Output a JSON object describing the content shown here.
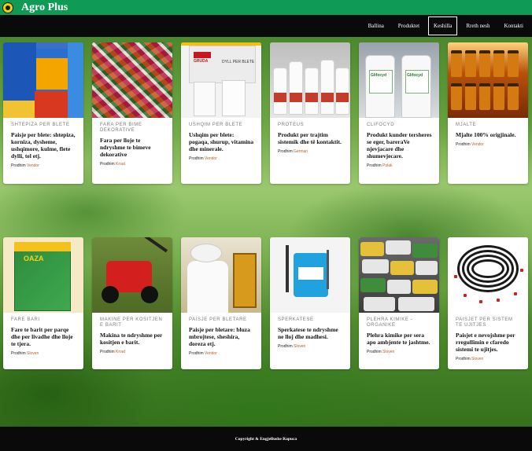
{
  "header": {
    "brand": "Agro Plus",
    "logo_icon": "sunflower-logo-icon"
  },
  "nav": {
    "items": [
      "Ballina",
      "Produktet",
      "Keshilla",
      "Rreth nesh",
      "Kontakti"
    ],
    "active": "Keshilla"
  },
  "origin_label": "Prodhim",
  "cards": [
    {
      "category": "Shtepiza per blete",
      "title": "Paisje per blete: shtepiza, korniza, dysheme, ushqimore, kulme, flete dylli, tel etj.",
      "origin": "Vendor"
    },
    {
      "category": "Fara per bime dekorative",
      "title": "Fara per lloje te ndryshme te bimeve dekorative",
      "origin": "Kroat"
    },
    {
      "category": "Ushqim per blete",
      "title": "Ushqim per blete: pogaqa, shurup, vitamina dhe minerale.",
      "origin": "Vendor"
    },
    {
      "category": "Proteus",
      "title": "Produkt per trajtim sistemik dhe të kontaktit.",
      "origin": "German"
    },
    {
      "category": "Clifocyd",
      "title": "Produkt kunder tersheres se eger, bareraVe njevjacare dhe shumevjecare.",
      "origin": "Polak"
    },
    {
      "category": "Mjalte",
      "title": "Mjalte 100% origjinale.",
      "origin": "Vendor"
    },
    {
      "category": "Fare bari",
      "title": "Fare te barit per parqe dhe per livadhe dhe lloje te tjera.",
      "origin": "Sloven"
    },
    {
      "category": "Makine per kositjen e barit",
      "title": "Makina te ndryshme per kositjen e barit.",
      "origin": "Kroat"
    },
    {
      "category": "Paisje per bletare",
      "title": "Paisje per bletare: bluza mbrojtese, sheshira, doreza etj.",
      "origin": "Vendor"
    },
    {
      "category": "Sperkatese",
      "title": "Sperkatese te ndryshme ne lloj dhe madhesi.",
      "origin": "Sloven"
    },
    {
      "category": "Plehra kimike - organike",
      "title": "Plehra kimike per sera apo ambjente te jashtme.",
      "origin": "Sloven"
    },
    {
      "category": "Paisjet per sistem te ujitjes",
      "title": "Paisjet e nevojshme per rregullimin e cfaredo sistemi te ujitjes.",
      "origin": "Sloven"
    }
  ],
  "image_texts": {
    "feed_brand": "GRUDA",
    "feed_box_text": "DYLL PER BLETE",
    "clifocyd_label": "Glifocyd",
    "oaza_name": "OAZA"
  },
  "footer": {
    "copyright": "Copyright & Engjellushe Rapuca"
  },
  "colors": {
    "header_green": "#0f9a56",
    "nav_black": "#0a0a0a",
    "origin_accent": "#b5602b"
  }
}
